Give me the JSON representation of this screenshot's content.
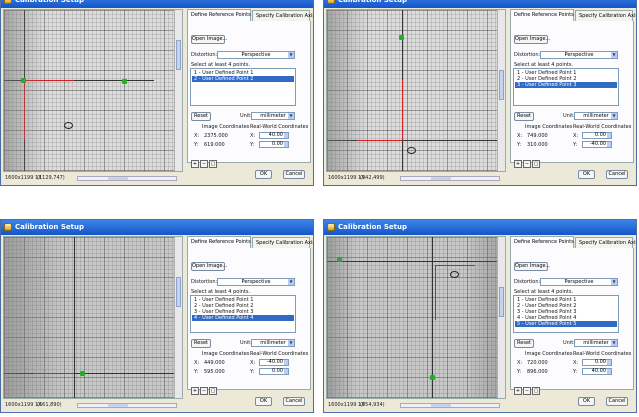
{
  "window_title": "Calibration Setup",
  "tabs": {
    "define": "Define Reference Points",
    "specify": "Specify Calibration Axis"
  },
  "buttons": {
    "open_image": "Open Image...",
    "reset": "Reset",
    "ok": "OK",
    "cancel": "Cancel"
  },
  "labels": {
    "distortion": "Distortion:",
    "select_points": "Select at least 4 points.",
    "unit": "Unit:",
    "image_coords": "Image Coordinates",
    "real_coords": "Real-World Coordinates",
    "x": "X:",
    "y": "Y:"
  },
  "distortion_value": "Perspective",
  "unit_value": "millimeter",
  "windows": [
    {
      "points": [
        "1 - User Defined Point 1",
        "2 - User Defined Point 2"
      ],
      "selected": 1,
      "image_x": "2375.000",
      "image_y": "619.000",
      "real_x": "40.00",
      "real_y": "0.00",
      "status": "1600x1199 1X",
      "cursor": "(1129,747)"
    },
    {
      "points": [
        "1 - User Defined Point 1",
        "2 - User Defined Point 2",
        "3 - User Defined Point 3"
      ],
      "selected": 2,
      "image_x": "749.000",
      "image_y": "310.000",
      "real_x": "0.00",
      "real_y": "-40.00",
      "status": "1600x1199 1X",
      "cursor": "(942,499)"
    },
    {
      "points": [
        "1 - User Defined Point 1",
        "2 - User Defined Point 2",
        "3 - User Defined Point 3",
        "4 - User Defined Point 4"
      ],
      "selected": 3,
      "image_x": "449.000",
      "image_y": "595.000",
      "real_x": "-40.00",
      "real_y": "0.00",
      "status": "1600x1199 1X",
      "cursor": "(661,890)"
    },
    {
      "points": [
        "1 - User Defined Point 1",
        "2 - User Defined Point 2",
        "3 - User Defined Point 3",
        "4 - User Defined Point 4",
        "5 - User Defined Point 5"
      ],
      "selected": 4,
      "image_x": "720.000",
      "image_y": "896.000",
      "real_x": "0.00",
      "real_y": "40.00",
      "status": "1600x1199 1X",
      "cursor": "(854,934)"
    }
  ],
  "icons": {
    "title": "calibration-icon",
    "zoom_in": "zoom-in-icon",
    "zoom_out": "zoom-out-icon",
    "zoom_fit": "zoom-fit-icon"
  }
}
